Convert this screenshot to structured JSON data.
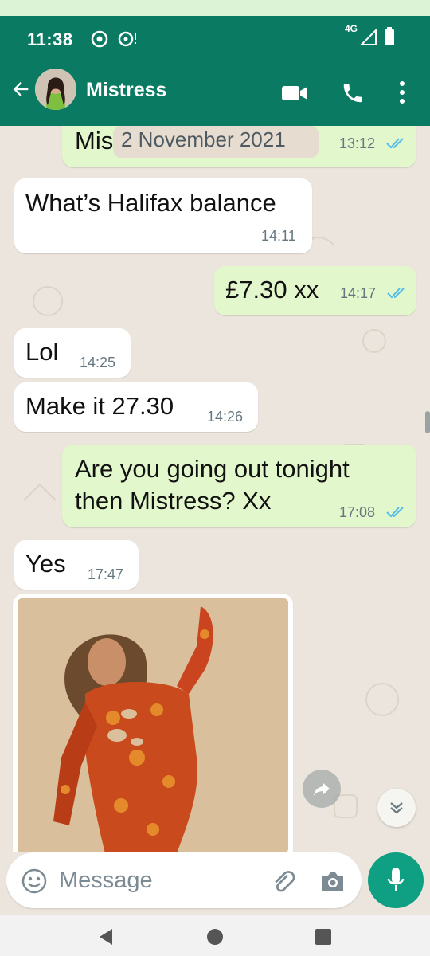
{
  "status_bar": {
    "time": "11:38",
    "network": "4G"
  },
  "header": {
    "contact_name": "Mistress"
  },
  "date_chip": "2 November 2021",
  "messages": [
    {
      "direction": "out",
      "text": "Mis",
      "time": "13:12",
      "read": true
    },
    {
      "direction": "in",
      "text": "What’s Halifax balance",
      "time": "14:11"
    },
    {
      "direction": "out",
      "text": "£7.30 xx",
      "time": "14:17",
      "read": true
    },
    {
      "direction": "in",
      "text": "Lol",
      "time": "14:25"
    },
    {
      "direction": "in",
      "text": "Make it 27.30",
      "time": "14:26"
    },
    {
      "direction": "out",
      "text_lines": [
        "Are you going out tonight",
        "then Mistress? Xx"
      ],
      "time": "17:08",
      "read": true
    },
    {
      "direction": "in",
      "text": "Yes",
      "time": "17:47"
    }
  ],
  "composer": {
    "placeholder": "Message"
  },
  "colors": {
    "header": "#0b7a63",
    "outgoing_bubble": "#e2f7cb",
    "incoming_bubble": "#ffffff",
    "read_ticks": "#53bdeb",
    "fab": "#0f9f82",
    "chat_background": "#ece5dd"
  },
  "icons": [
    "back-arrow-icon",
    "video-call-icon",
    "phone-icon",
    "more-vert-icon",
    "emoji-icon",
    "attach-icon",
    "camera-icon",
    "mic-icon",
    "forward-icon",
    "scroll-down-icon"
  ]
}
